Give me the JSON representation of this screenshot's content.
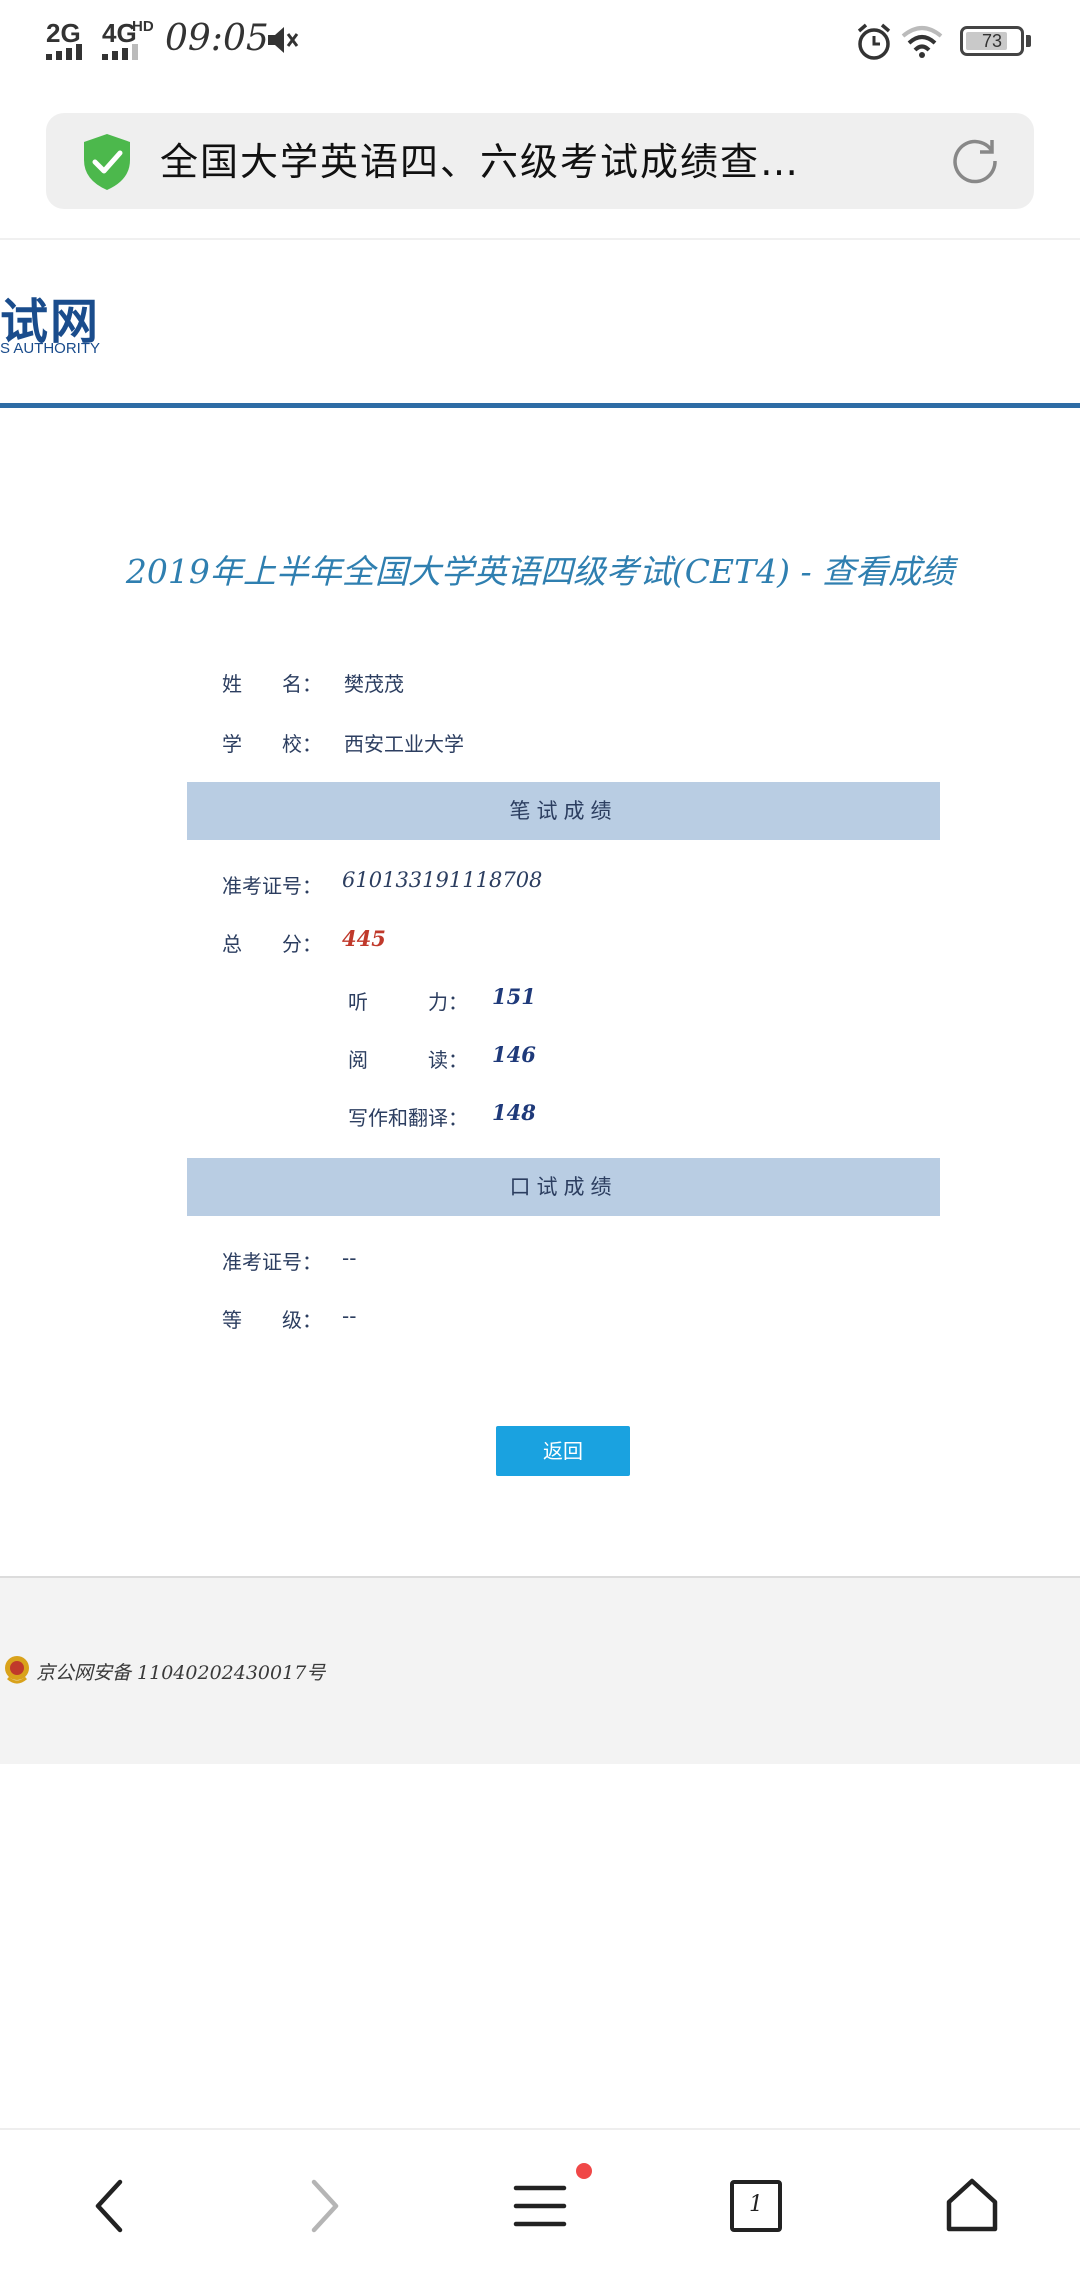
{
  "status_bar": {
    "signal_1": "2G",
    "signal_2": "4G",
    "signal_2_badge": "HD",
    "time": "09:05",
    "battery": "73",
    "icons": [
      "mute-icon",
      "alarm-icon",
      "wifi-icon",
      "battery-icon"
    ]
  },
  "browser": {
    "tab_title": "全国大学英语四、六级考试成绩查…",
    "icons": [
      "shield-check-icon",
      "refresh-icon"
    ]
  },
  "site_header": {
    "logo_text": "试网",
    "logo_subtext": "S AUTHORITY"
  },
  "page": {
    "title": "2019年上半年全国大学英语四级考试(CET4) - 查看成绩",
    "name_label": "姓　　名：",
    "name_value": "樊茂茂",
    "school_label": "学　　校：",
    "school_value": "西安工业大学"
  },
  "written": {
    "section_title": "笔试成绩",
    "ticket_label": "准考证号：",
    "ticket_value": "610133191118708",
    "total_label": "总　　分：",
    "total_value": "445",
    "listening_label": "听　　　力：",
    "listening_value": "151",
    "reading_label": "阅　　　读：",
    "reading_value": "146",
    "writing_label": "写作和翻译：",
    "writing_value": "148"
  },
  "oral": {
    "section_title": "口试成绩",
    "ticket_label": "准考证号：",
    "ticket_value": "--",
    "grade_label": "等　　级：",
    "grade_value": "--"
  },
  "actions": {
    "return_label": "返回"
  },
  "footer": {
    "beian": "京公网安备 11040202430017号"
  },
  "nav_bar": {
    "tabs_count": "1",
    "icons": [
      "back-icon",
      "forward-icon",
      "menu-icon",
      "tabs-icon",
      "home-icon"
    ]
  },
  "colors": {
    "accent": "#1aa2e0",
    "header_blue": "#2e6ca5",
    "section_bg": "#b9cde3",
    "total_red": "#c0392b",
    "title_blue": "#2f7fb0"
  }
}
